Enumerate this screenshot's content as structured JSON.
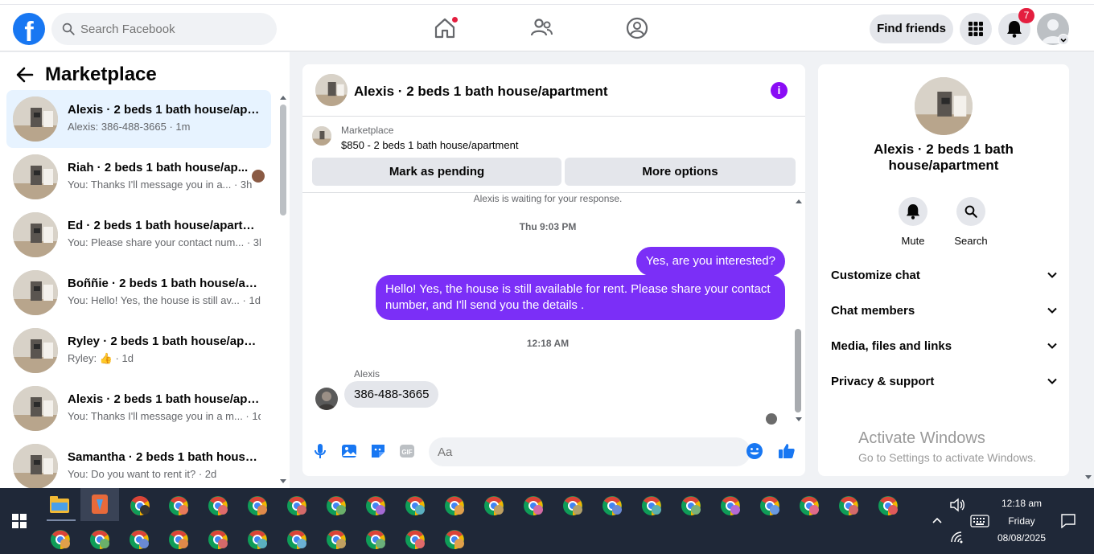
{
  "topnav": {
    "logo": "f",
    "search_placeholder": "Search Facebook",
    "find_friends": "Find friends",
    "notification_count": "7"
  },
  "sidebar": {
    "title": "Marketplace",
    "conversations": [
      {
        "title": "Alexis · 2 beds 1 bath house/apa...",
        "sub": "Alexis: 386-488-3665 · 1m"
      },
      {
        "title": "Riah · 2 beds 1 bath house/ap...",
        "sub": "You: Thanks I'll message you in a... · 3h"
      },
      {
        "title": "Ed · 2 beds 1 bath house/apartm...",
        "sub": "You: Please share your contact num... · 3h"
      },
      {
        "title": "Boññie · 2 beds 1 bath house/ap...",
        "sub": "You: Hello! Yes, the house is still av... · 1d"
      },
      {
        "title": "Ryley · 2 beds 1 bath house/apar...",
        "sub": "Ryley: 👍 · 1d"
      },
      {
        "title": "Alexis · 2 beds 1 bath house/apa...",
        "sub": "You: Thanks I'll message you in a m... · 1d"
      },
      {
        "title": "Samantha · 2 beds 1 bath house...",
        "sub": "You: Do you want to rent it? · 2d"
      }
    ]
  },
  "chat": {
    "name": "Alexis · 2 beds 1 bath house/apartment",
    "info": "i",
    "marketplace_label": "Marketplace",
    "listing": "$850 - 2 beds 1 bath house/apartment",
    "mark_pending": "Mark as pending",
    "more_options": "More options",
    "waiting": "Alexis is waiting for your response.",
    "time1": "Thu 9:03 PM",
    "out_msg1": "Yes, are you interested?",
    "out_msg2": "Hello! Yes, the house is still available for rent. Please share your contact number, and I'll send you the details .",
    "time2": "12:18 AM",
    "sender": "Alexis",
    "in_msg": "386-488-3665",
    "input_placeholder": "Aa"
  },
  "rightpanel": {
    "name": "Alexis · 2 beds 1 bath house/apartment",
    "mute": "Mute",
    "search": "Search",
    "rows": [
      "Customize chat",
      "Chat members",
      "Media, files and links",
      "Privacy & support"
    ]
  },
  "watermark": {
    "line1": "Activate Windows",
    "line2": "Go to Settings to activate Windows."
  },
  "taskbar": {
    "time": "12:18 am",
    "day": "Friday",
    "date": "08/08/2025"
  },
  "colors": {
    "brand": "#1877f2",
    "outgoing_bubble": "#7b2ff7",
    "info": "#8a0cf5",
    "badge": "#e41e3f"
  }
}
